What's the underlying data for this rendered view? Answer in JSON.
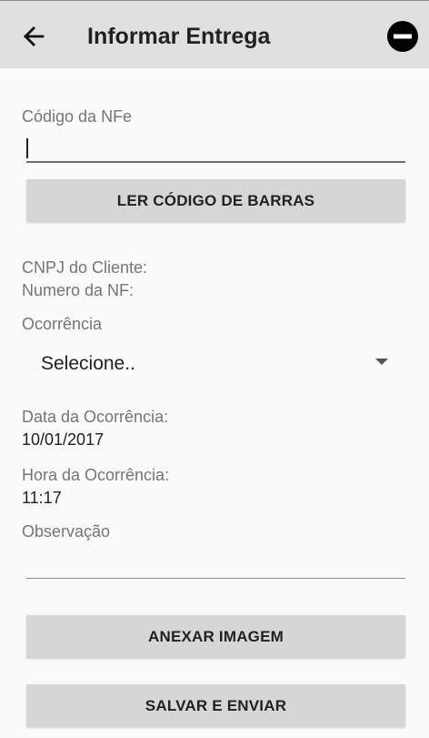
{
  "app_bar": {
    "title": "Informar Entrega",
    "back_icon": "arrow-back-icon",
    "action_icon": "minus-circle-icon"
  },
  "form": {
    "nfe_code": {
      "label": "Código da NFe",
      "value": ""
    },
    "scan_button_label": "LER CÓDIGO DE BARRAS",
    "cnpj_label": "CNPJ do Cliente:",
    "nf_number_label": "Numero da NF:",
    "occurrence": {
      "label": "Ocorrência",
      "selected": "Selecione.."
    },
    "occurrence_date": {
      "label": "Data da Ocorrência:",
      "value": "10/01/2017"
    },
    "occurrence_time": {
      "label": "Hora da Ocorrência:",
      "value": "11:17"
    },
    "observation": {
      "label": "Observação",
      "value": ""
    },
    "attach_button_label": "ANEXAR IMAGEM",
    "save_button_label": "SALVAR E ENVIAR"
  },
  "colors": {
    "app_bar_bg": "#e0e0e0",
    "button_bg": "#d6d6d6",
    "label_text": "#757575",
    "primary_text": "#212121"
  }
}
